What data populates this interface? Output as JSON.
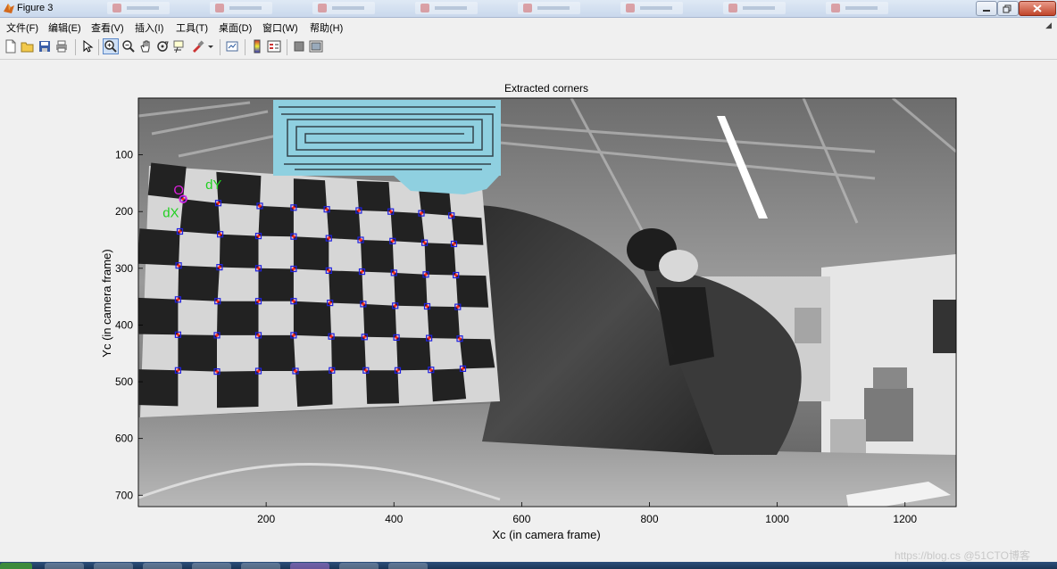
{
  "window": {
    "title": "Figure 3",
    "colors": {
      "titlebar": "#dfe9f5",
      "close_button": "#c0452b"
    }
  },
  "menu": [
    {
      "label": "文件(F)"
    },
    {
      "label": "编辑(E)"
    },
    {
      "label": "查看(V)"
    },
    {
      "label": "插入(I)"
    },
    {
      "label": "工具(T)"
    },
    {
      "label": "桌面(D)"
    },
    {
      "label": "窗口(W)"
    },
    {
      "label": "帮助(H)"
    }
  ],
  "menu_overflow_icon": "small-arrow-icon",
  "toolbar": [
    {
      "name": "new-figure-icon",
      "active": false
    },
    {
      "name": "open-file-icon",
      "active": false
    },
    {
      "name": "save-icon",
      "active": false
    },
    {
      "name": "print-icon",
      "active": false
    },
    {
      "name": "edit-plot-arrow-icon",
      "active": false
    },
    {
      "name": "zoom-in-icon",
      "active": true
    },
    {
      "name": "zoom-out-icon",
      "active": false
    },
    {
      "name": "pan-hand-icon",
      "active": false
    },
    {
      "name": "rotate-3d-icon",
      "active": false
    },
    {
      "name": "data-cursor-icon",
      "active": false
    },
    {
      "name": "brush-icon",
      "active": false
    },
    {
      "name": "link-plot-icon",
      "active": false
    },
    {
      "name": "colorbar-icon",
      "active": false
    },
    {
      "name": "legend-icon",
      "active": false
    },
    {
      "name": "hide-plot-tools-icon",
      "active": false
    },
    {
      "name": "show-plot-tools-icon",
      "active": false
    }
  ],
  "chart_data": {
    "type": "scatter",
    "title": "Extracted corners",
    "xlabel": "Xc (in camera frame)",
    "ylabel": "Yc (in camera frame)",
    "xlim": [
      0,
      1280
    ],
    "ylim": [
      0,
      720
    ],
    "y_reversed": true,
    "x_ticks": [
      200,
      400,
      600,
      800,
      1000,
      1200
    ],
    "y_ticks": [
      100,
      200,
      300,
      400,
      500,
      600,
      700
    ],
    "background_image": "grayscale office photo with checkerboard calibration target",
    "corner_marker_color": "#2020e0",
    "corner_fill_color": "#ff2020",
    "annotations": [
      {
        "text": "O",
        "x": 55,
        "y": 170,
        "color": "#e020e0"
      },
      {
        "text": "dY",
        "x": 105,
        "y": 160,
        "color": "#20d020"
      },
      {
        "text": "dX",
        "x": 38,
        "y": 210,
        "color": "#20d020"
      }
    ],
    "corners": [
      [
        [
          70,
          178
        ],
        [
          125,
          185
        ],
        [
          190,
          190
        ],
        [
          243,
          193
        ],
        [
          295,
          196
        ],
        [
          345,
          198
        ],
        [
          395,
          200
        ],
        [
          443,
          203
        ],
        [
          490,
          207
        ]
      ],
      [
        [
          65,
          235
        ],
        [
          128,
          240
        ],
        [
          188,
          243
        ],
        [
          243,
          244
        ],
        [
          298,
          247
        ],
        [
          348,
          250
        ],
        [
          398,
          252
        ],
        [
          448,
          255
        ],
        [
          494,
          257
        ]
      ],
      [
        [
          63,
          295
        ],
        [
          127,
          298
        ],
        [
          188,
          300
        ],
        [
          243,
          301
        ],
        [
          298,
          304
        ],
        [
          350,
          306
        ],
        [
          400,
          308
        ],
        [
          450,
          311
        ],
        [
          497,
          312
        ]
      ],
      [
        [
          62,
          355
        ],
        [
          124,
          358
        ],
        [
          188,
          358
        ],
        [
          243,
          358
        ],
        [
          300,
          361
        ],
        [
          352,
          363
        ],
        [
          402,
          366
        ],
        [
          452,
          367
        ],
        [
          500,
          368
        ]
      ],
      [
        [
          62,
          417
        ],
        [
          123,
          418
        ],
        [
          188,
          418
        ],
        [
          243,
          418
        ],
        [
          302,
          420
        ],
        [
          354,
          421
        ],
        [
          404,
          422
        ],
        [
          455,
          423
        ],
        [
          503,
          424
        ]
      ],
      [
        [
          62,
          480
        ],
        [
          123,
          482
        ],
        [
          188,
          481
        ],
        [
          246,
          481
        ],
        [
          303,
          480
        ],
        [
          356,
          480
        ],
        [
          406,
          480
        ],
        [
          458,
          479
        ],
        [
          508,
          477
        ]
      ]
    ]
  },
  "watermark": "https://blog.cs @51CTO博客"
}
